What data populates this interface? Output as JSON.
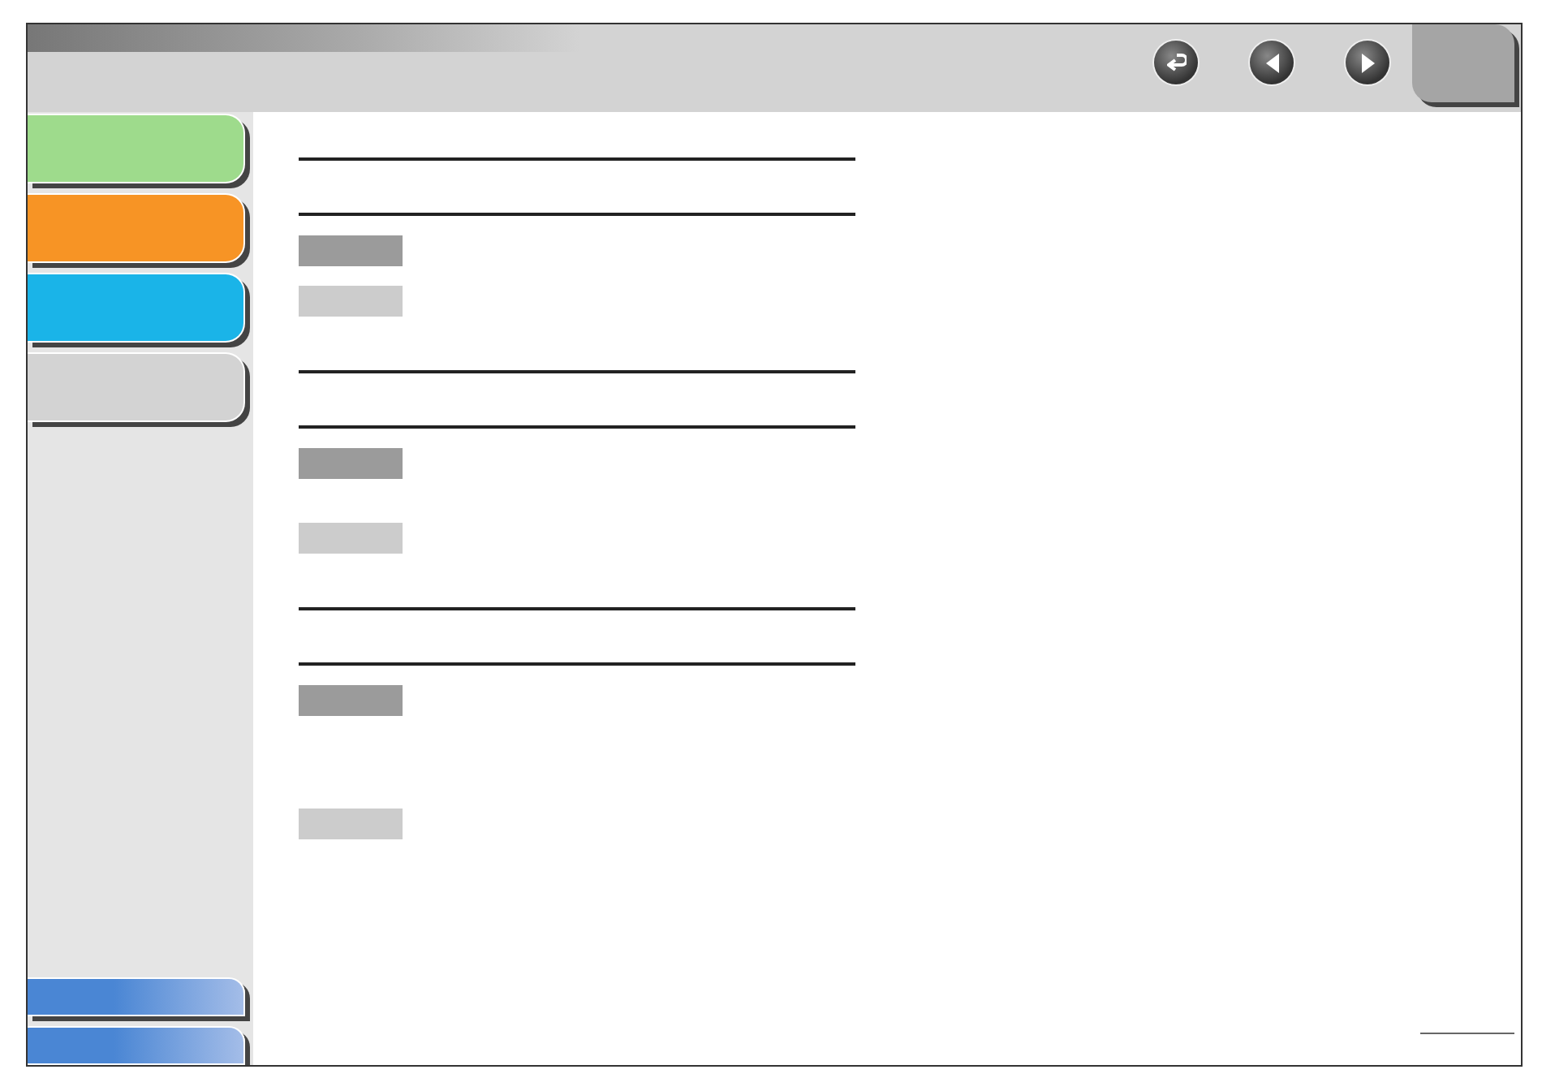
{
  "side_tabs": [
    {
      "color": "#9edb8c"
    },
    {
      "color": "#f79425"
    },
    {
      "color": "#1ab4e8"
    },
    {
      "color": "#d3d3d3"
    }
  ],
  "sections": [
    {
      "tags": [
        {
          "kind": "dark"
        },
        {
          "kind": "light"
        }
      ]
    },
    {
      "tags": [
        {
          "kind": "dark"
        },
        {
          "kind": "light"
        }
      ]
    },
    {
      "tags": [
        {
          "kind": "dark"
        },
        {
          "kind": "light"
        }
      ]
    }
  ]
}
